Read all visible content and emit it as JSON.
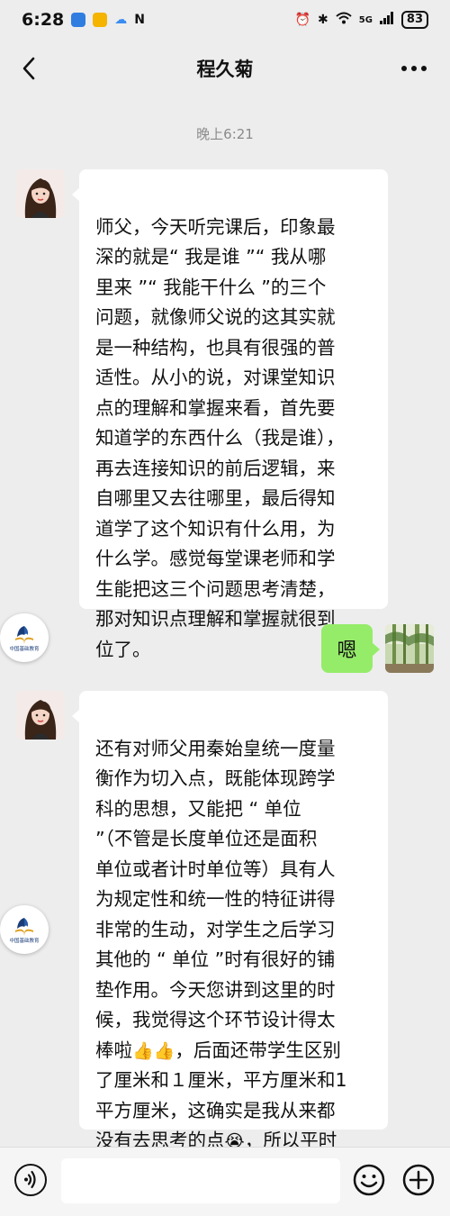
{
  "status_bar": {
    "time": "6:28",
    "network": "5G",
    "battery": "83",
    "colors": {
      "notif1": "#2f7de1",
      "notif2": "#f4b400",
      "notif3": "#3a8cf0"
    }
  },
  "nav": {
    "title": "程久菊",
    "back_icon": "chevron-left-icon",
    "more_icon": "more-icon"
  },
  "chat": {
    "timestamp": "晚上6:21",
    "messages": [
      {
        "side": "left",
        "text": "师父，今天听完课后，印象最\n深的就是“ 我是谁 ”“ 我从哪\n里来 ”“ 我能干什么 ”的三个\n问题，就像师父说的这其实就\n是一种结构，也具有很强的普\n适性。从小的说，对课堂知识\n点的理解和掌握来看，首先要\n知道学的东西什么（我是谁），\n再去连接知识的前后逻辑，来\n自哪里又去往哪里，最后得知\n道学了这个知识有什么用，为\n什么学。感觉每堂课老师和学\n生能把这三个问题思考清楚，\n那对知识点理解和掌握就很到\n位了。"
      },
      {
        "side": "right",
        "text": "嗯"
      },
      {
        "side": "left",
        "part1": "还有对师父用秦始皇统一度量\n衡作为切入点，既能体现跨学\n科的思想，又能把 “ 单位\n”（不管是长度单位还是面积\n单位或者计时单位等）具有人\n为规定性和统一性的特征讲得\n非常的生动，对学生之后学习\n其他的 “ 单位 ”时有很好的铺\n垫作用。今天您讲到这里的时\n候，我觉得这个环节设计得太\n棒啦",
        "emoji1": "👍👍",
        "part2": "，后面还带学生区别\n了厘米和１厘米，平方厘米和1\n平方厘米，这确实是我从来都\n没有去思考的点",
        "emoji2": "😭",
        "part3": "，所以平时\n还是要多去听课，看课。"
      }
    ],
    "float_logo_text": "中国基础教育"
  },
  "input_bar": {
    "placeholder": "",
    "voice_icon": "voice-icon",
    "emoji_icon": "emoji-icon",
    "plus_icon": "plus-icon"
  },
  "colors": {
    "background": "#ededed",
    "bubble_left": "#ffffff",
    "bubble_right": "#95ec69"
  }
}
